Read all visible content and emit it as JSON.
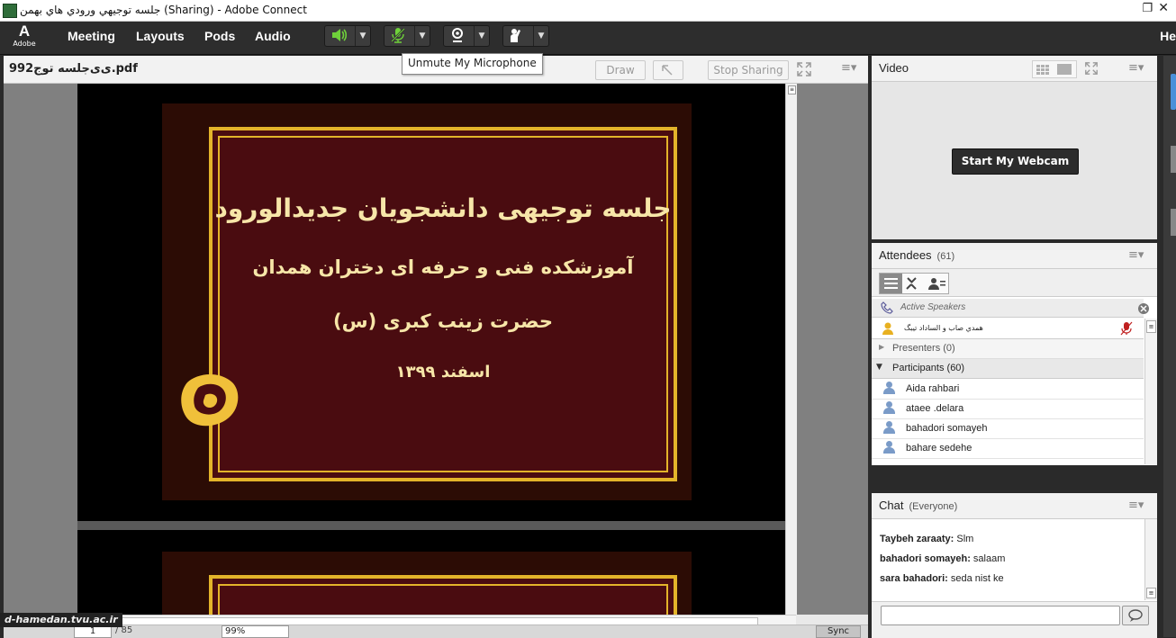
{
  "window": {
    "title": "جلسه توجيهي ورودي هاي بهمن (Sharing) - Adobe Connect",
    "maximize_glyph": "❐",
    "close_glyph": "✕"
  },
  "menubar": {
    "logo_text": "Adobe",
    "items": [
      "Meeting",
      "Layouts",
      "Pods",
      "Audio"
    ],
    "truncated_item": "He",
    "speaker_icon": "speaker-icon",
    "mic_icon": "mic-muted-icon",
    "camera_icon": "webcam-icon",
    "raise_hand_icon": "raise-hand-icon"
  },
  "tooltip": "Unmute My Microphone",
  "share_pod": {
    "filename": "ی‌ی‌جلسه توج992.pdf",
    "buttons": {
      "draw": "Draw",
      "stop": "Stop Sharing"
    },
    "slide": {
      "line1": "جلسه توجیهی دانشجویان جدیدالورود",
      "line2": "آموزشکده فنی و حرفه ای دختران همدان",
      "line3": "حضرت زینب کبری (س)",
      "line4": "اسفند ۱۳۹۹"
    },
    "page_current": "1",
    "page_total": "/ 85",
    "zoom": "99%",
    "sync": "Sync"
  },
  "watermark": "d-hamedan.tvu.ac.ir",
  "video_pod": {
    "title": "Video",
    "webcam_button": "Start My Webcam"
  },
  "attendees_pod": {
    "title": "Attendees",
    "count": "(61)",
    "active_speakers": "Active Speakers",
    "active_speaker_name": "همدي  صاب و الساداد تيبگ",
    "presenters": "Presenters (0)",
    "participants": "Participants (60)",
    "rows": [
      "Aida rahbari",
      "ataee .delara",
      "bahadori somayeh",
      "bahare sedehe"
    ]
  },
  "chat_pod": {
    "title": "Chat",
    "scope": "(Everyone)",
    "messages": [
      {
        "name": "Taybeh zaraaty:",
        "text": "Slm"
      },
      {
        "name": "bahadori somayeh:",
        "text": "salaam"
      },
      {
        "name": "sara bahadori:",
        "text": "seda nist ke"
      }
    ]
  },
  "colors": {
    "accent_green": "#6fd13a",
    "slide_gold": "#e3b42a",
    "slide_maroon": "#4a0c10"
  }
}
